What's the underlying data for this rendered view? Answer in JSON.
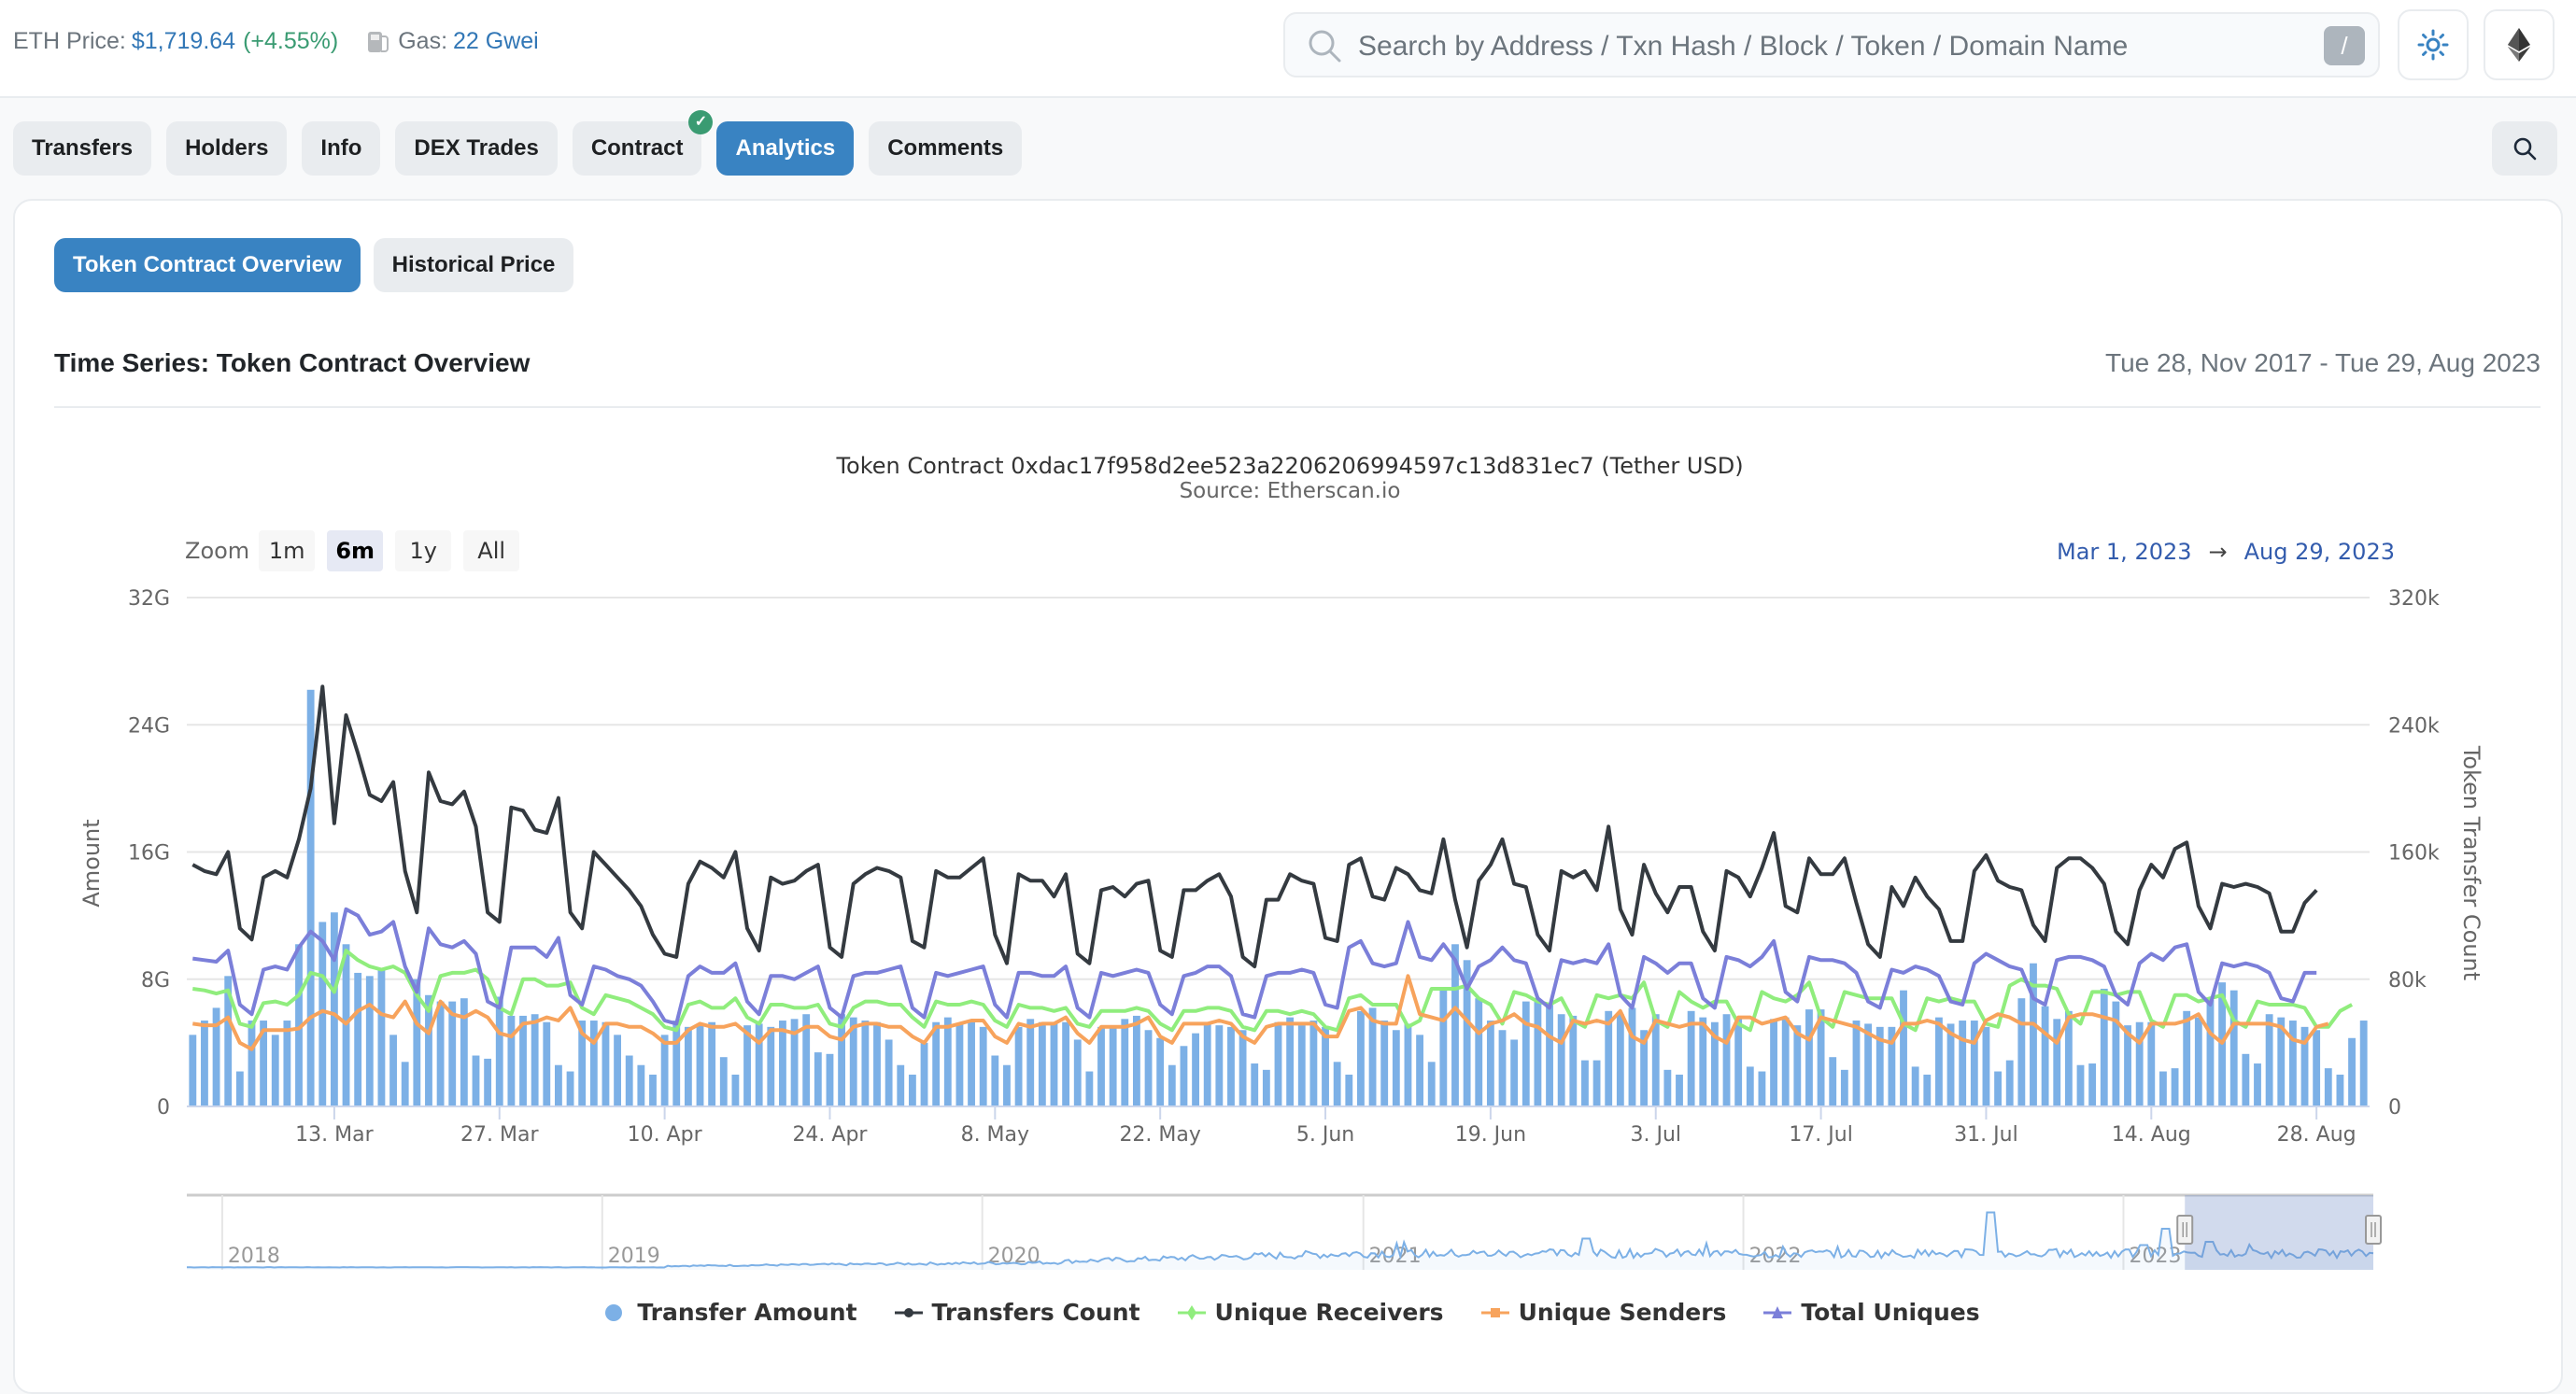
{
  "header": {
    "eth_price_label": "ETH Price:",
    "eth_price_value": "$1,719.64",
    "eth_price_change": "(+4.55%)",
    "gas_label": "Gas:",
    "gas_value": "22 Gwei",
    "search_placeholder": "Search by Address / Txn Hash / Block / Token / Domain Name",
    "search_shortcut": "/",
    "theme_icon": "sun-icon",
    "network_icon": "ethereum-icon"
  },
  "tabs": [
    {
      "label": "Transfers",
      "active": false
    },
    {
      "label": "Holders",
      "active": false
    },
    {
      "label": "Info",
      "active": false
    },
    {
      "label": "DEX Trades",
      "active": false
    },
    {
      "label": "Contract",
      "active": false,
      "verified": true
    },
    {
      "label": "Analytics",
      "active": true
    },
    {
      "label": "Comments",
      "active": false
    }
  ],
  "subtabs": [
    {
      "label": "Token Contract Overview",
      "active": true
    },
    {
      "label": "Historical Price",
      "active": false
    }
  ],
  "section": {
    "title": "Time Series: Token Contract Overview",
    "date_range": "Tue 28, Nov 2017 - Tue 29, Aug 2023"
  },
  "chart_controls": {
    "zoom_label": "Zoom",
    "zoom_options": [
      "1m",
      "6m",
      "1y",
      "All"
    ],
    "zoom_selected": "6m",
    "range_from": "Mar 1, 2023",
    "range_arrow": "→",
    "range_to": "Aug 29, 2023"
  },
  "chart_data": {
    "type": "bar+line",
    "title": "Token Contract 0xdac17f958d2ee523a2206206994597c13d831ec7 (Tether USD)",
    "subtitle": "Source: Etherscan.io",
    "x_start": "2023-03-01",
    "x_end": "2023-08-29",
    "x_ticks": [
      "13. Mar",
      "27. Mar",
      "10. Apr",
      "24. Apr",
      "8. May",
      "22. May",
      "5. Jun",
      "19. Jun",
      "3. Jul",
      "17. Jul",
      "31. Jul",
      "14. Aug",
      "28. Aug"
    ],
    "x_tick_day_index": [
      12,
      26,
      40,
      54,
      68,
      82,
      96,
      110,
      124,
      138,
      152,
      166,
      180
    ],
    "y_left": {
      "label": "Amount",
      "ticks": [
        "0",
        "8G",
        "16G",
        "24G",
        "32G"
      ],
      "range": [
        0,
        32
      ]
    },
    "y_right": {
      "label": "Token Transfer Count",
      "ticks": [
        "0",
        "80k",
        "160k",
        "240k",
        "320k"
      ],
      "range": [
        0,
        320
      ]
    },
    "grid": true,
    "legend_position": "bottom",
    "series": [
      {
        "name": "Transfer Amount",
        "type": "bar",
        "axis": "left",
        "unit": "G",
        "color": "#7cb0e6",
        "values": [
          4.5,
          5.4,
          6.2,
          8.2,
          2.2,
          5.4,
          5.4,
          4.5,
          5.4,
          10.2,
          26.2,
          11.6,
          12.2,
          10.2,
          8.4,
          8.2,
          8.7,
          4.5,
          2.8,
          8.0,
          7.0,
          6.6,
          6.6,
          6.8,
          3.2,
          3.0,
          6.9,
          5.7,
          5.7,
          5.8,
          5.3,
          2.6,
          2.2,
          5.4,
          5.4,
          5.3,
          4.5,
          3.2,
          2.6,
          2.0,
          4.5,
          5.4,
          5.0,
          5.2,
          5.3,
          3.1,
          2.0,
          5.1,
          5.2,
          5.0,
          5.4,
          5.5,
          5.8,
          3.4,
          3.3,
          5.8,
          5.6,
          5.4,
          5.3,
          4.2,
          2.6,
          2.0,
          4.0,
          5.3,
          5.6,
          5.2,
          5.4,
          5.0,
          3.2,
          2.6,
          5.0,
          5.5,
          5.3,
          5.2,
          5.3,
          4.2,
          2.2,
          5.0,
          5.0,
          5.5,
          5.7,
          4.8,
          4.3,
          2.6,
          3.8,
          4.6,
          5.2,
          5.1,
          5.0,
          4.8,
          2.7,
          2.3,
          5.3,
          5.6,
          5.1,
          5.4,
          5.0,
          2.8,
          2.0,
          6.0,
          6.2,
          5.4,
          4.8,
          5.2,
          4.5,
          2.8,
          7.4,
          10.2,
          9.2,
          6.8,
          5.4,
          4.8,
          4.2,
          6.6,
          6.6,
          6.4,
          5.8,
          5.7,
          2.9,
          2.9,
          6.0,
          5.8,
          6.2,
          4.8,
          5.8,
          2.3,
          2.0,
          6.0,
          5.6,
          5.3,
          5.8,
          5.5,
          2.5,
          2.2,
          5.5,
          5.6,
          5.1,
          6.1,
          6.1,
          3.1,
          2.3,
          5.4,
          5.2,
          5.0,
          5.0,
          7.3,
          2.5,
          2.0,
          5.6,
          5.2,
          5.4,
          5.4,
          5.0,
          2.2,
          2.9,
          6.8,
          9.0,
          6.3,
          5.5,
          6.0,
          2.6,
          2.7,
          7.4,
          6.6,
          5.1,
          5.3,
          5.3,
          2.2,
          2.4,
          6.0,
          5.6,
          6.7,
          7.8,
          7.3,
          3.3,
          2.7,
          5.8,
          5.6,
          5.4,
          5.0,
          4.8,
          2.4,
          2.0,
          4.3,
          5.4
        ]
      },
      {
        "name": "Transfers Count",
        "type": "line",
        "axis": "right",
        "unit": "k",
        "color": "#343a40",
        "values": [
          152,
          148,
          146,
          160,
          112,
          105,
          144,
          148,
          144,
          168,
          200,
          264,
          178,
          246,
          222,
          196,
          192,
          204,
          148,
          122,
          210,
          192,
          190,
          198,
          176,
          122,
          116,
          188,
          186,
          174,
          172,
          194,
          122,
          112,
          160,
          152,
          144,
          136,
          126,
          108,
          96,
          94,
          140,
          154,
          150,
          144,
          160,
          112,
          98,
          144,
          140,
          142,
          148,
          152,
          100,
          94,
          140,
          146,
          150,
          148,
          144,
          104,
          100,
          148,
          144,
          144,
          150,
          156,
          108,
          90,
          146,
          142,
          142,
          132,
          146,
          96,
          90,
          136,
          138,
          132,
          140,
          142,
          98,
          94,
          136,
          136,
          142,
          146,
          132,
          94,
          88,
          130,
          130,
          146,
          142,
          140,
          106,
          104,
          152,
          156,
          132,
          130,
          150,
          146,
          136,
          134,
          168,
          130,
          100,
          142,
          152,
          168,
          140,
          138,
          108,
          98,
          148,
          144,
          148,
          136,
          176,
          124,
          108,
          152,
          134,
          122,
          138,
          138,
          110,
          98,
          148,
          144,
          132,
          150,
          172,
          126,
          122,
          156,
          146,
          146,
          156,
          128,
          102,
          94,
          138,
          126,
          144,
          132,
          124,
          104,
          104,
          148,
          158,
          142,
          138,
          136,
          114,
          104,
          150,
          156,
          156,
          150,
          140,
          110,
          102,
          136,
          152,
          144,
          162,
          166,
          126,
          112,
          140,
          138,
          140,
          138,
          134,
          110,
          110,
          128,
          136
        ]
      },
      {
        "name": "Unique Receivers",
        "type": "line",
        "axis": "right",
        "unit": "k",
        "color": "#90ed7d",
        "values": [
          74,
          73,
          71,
          73,
          52,
          50,
          65,
          66,
          64,
          70,
          84,
          82,
          72,
          98,
          92,
          88,
          86,
          88,
          84,
          70,
          60,
          82,
          84,
          84,
          86,
          80,
          62,
          58,
          80,
          80,
          76,
          76,
          78,
          62,
          58,
          70,
          68,
          66,
          62,
          58,
          50,
          48,
          64,
          66,
          62,
          62,
          68,
          56,
          52,
          64,
          64,
          62,
          62,
          64,
          52,
          50,
          62,
          66,
          66,
          64,
          64,
          56,
          50,
          66,
          64,
          64,
          66,
          64,
          54,
          50,
          64,
          62,
          62,
          60,
          62,
          52,
          50,
          60,
          60,
          60,
          62,
          60,
          52,
          48,
          60,
          60,
          62,
          62,
          60,
          50,
          48,
          60,
          60,
          58,
          60,
          58,
          50,
          48,
          68,
          70,
          64,
          64,
          64,
          50,
          54,
          74,
          74,
          74,
          76,
          68,
          64,
          52,
          72,
          70,
          66,
          64,
          68,
          54,
          50,
          70,
          68,
          70,
          68,
          78,
          54,
          50,
          72,
          66,
          62,
          66,
          66,
          52,
          48,
          72,
          68,
          66,
          70,
          78,
          56,
          50,
          72,
          70,
          68,
          68,
          68,
          52,
          48,
          68,
          66,
          68,
          66,
          66,
          52,
          50,
          76,
          80,
          76,
          76,
          74,
          58,
          52,
          72,
          72,
          70,
          72,
          72,
          54,
          50,
          70,
          70,
          66,
          68,
          70,
          54,
          50,
          66,
          64,
          64,
          64,
          62,
          50,
          50,
          60,
          64
        ]
      },
      {
        "name": "Unique Senders",
        "type": "line",
        "axis": "right",
        "unit": "k",
        "color": "#f7a35c",
        "values": [
          52,
          51,
          51,
          56,
          40,
          36,
          48,
          48,
          48,
          49,
          56,
          60,
          58,
          52,
          60,
          64,
          58,
          56,
          66,
          52,
          46,
          66,
          58,
          56,
          60,
          56,
          46,
          44,
          52,
          53,
          56,
          54,
          62,
          46,
          40,
          52,
          52,
          50,
          50,
          46,
          40,
          40,
          48,
          52,
          50,
          50,
          52,
          46,
          40,
          48,
          48,
          46,
          50,
          50,
          44,
          42,
          50,
          52,
          52,
          50,
          50,
          44,
          40,
          50,
          50,
          52,
          54,
          54,
          44,
          40,
          52,
          50,
          52,
          52,
          56,
          46,
          40,
          50,
          50,
          50,
          52,
          56,
          44,
          40,
          52,
          52,
          52,
          54,
          52,
          44,
          40,
          50,
          52,
          52,
          52,
          52,
          44,
          44,
          60,
          62,
          54,
          52,
          52,
          82,
          58,
          56,
          54,
          62,
          54,
          46,
          52,
          54,
          58,
          52,
          50,
          44,
          40,
          54,
          52,
          54,
          52,
          60,
          44,
          40,
          54,
          52,
          50,
          52,
          52,
          44,
          40,
          56,
          56,
          52,
          54,
          56,
          46,
          42,
          56,
          54,
          52,
          50,
          46,
          42,
          40,
          52,
          52,
          54,
          52,
          46,
          42,
          40,
          54,
          58,
          56,
          52,
          52,
          46,
          40,
          56,
          58,
          58,
          56,
          54,
          46,
          40,
          52,
          52,
          52,
          54,
          58,
          46,
          40,
          52,
          52,
          52,
          52,
          50,
          42,
          40,
          50,
          52
        ]
      },
      {
        "name": "Total Uniques",
        "type": "line",
        "axis": "right",
        "unit": "k",
        "color": "#7b7fd9",
        "values": [
          93,
          92,
          91,
          98,
          64,
          58,
          86,
          88,
          86,
          100,
          110,
          104,
          92,
          124,
          120,
          108,
          110,
          116,
          88,
          72,
          112,
          102,
          100,
          104,
          96,
          66,
          62,
          100,
          100,
          100,
          94,
          106,
          70,
          64,
          88,
          86,
          82,
          80,
          76,
          66,
          54,
          52,
          82,
          88,
          84,
          84,
          90,
          66,
          58,
          82,
          82,
          80,
          84,
          88,
          62,
          56,
          82,
          84,
          84,
          86,
          88,
          62,
          56,
          84,
          82,
          84,
          86,
          88,
          64,
          56,
          84,
          84,
          82,
          82,
          88,
          62,
          56,
          84,
          82,
          84,
          86,
          84,
          64,
          58,
          82,
          84,
          88,
          88,
          82,
          58,
          56,
          82,
          84,
          84,
          86,
          84,
          64,
          62,
          100,
          104,
          90,
          88,
          90,
          116,
          94,
          92,
          102,
          92,
          74,
          88,
          92,
          100,
          92,
          90,
          68,
          62,
          92,
          90,
          92,
          90,
          102,
          70,
          62,
          94,
          90,
          84,
          90,
          90,
          68,
          62,
          94,
          92,
          88,
          94,
          104,
          72,
          66,
          94,
          92,
          92,
          90,
          84,
          66,
          62,
          86,
          84,
          88,
          86,
          82,
          66,
          64,
          90,
          96,
          92,
          88,
          86,
          68,
          64,
          92,
          94,
          94,
          92,
          88,
          70,
          64,
          90,
          96,
          92,
          100,
          102,
          72,
          64,
          90,
          88,
          90,
          88,
          84,
          68,
          66,
          84,
          84
        ]
      }
    ],
    "navigator": {
      "year_labels": [
        "2018",
        "2019",
        "2020",
        "2021",
        "2022",
        "2023"
      ],
      "selected_from": "2023-03-01",
      "selected_to": "2023-08-29"
    }
  }
}
